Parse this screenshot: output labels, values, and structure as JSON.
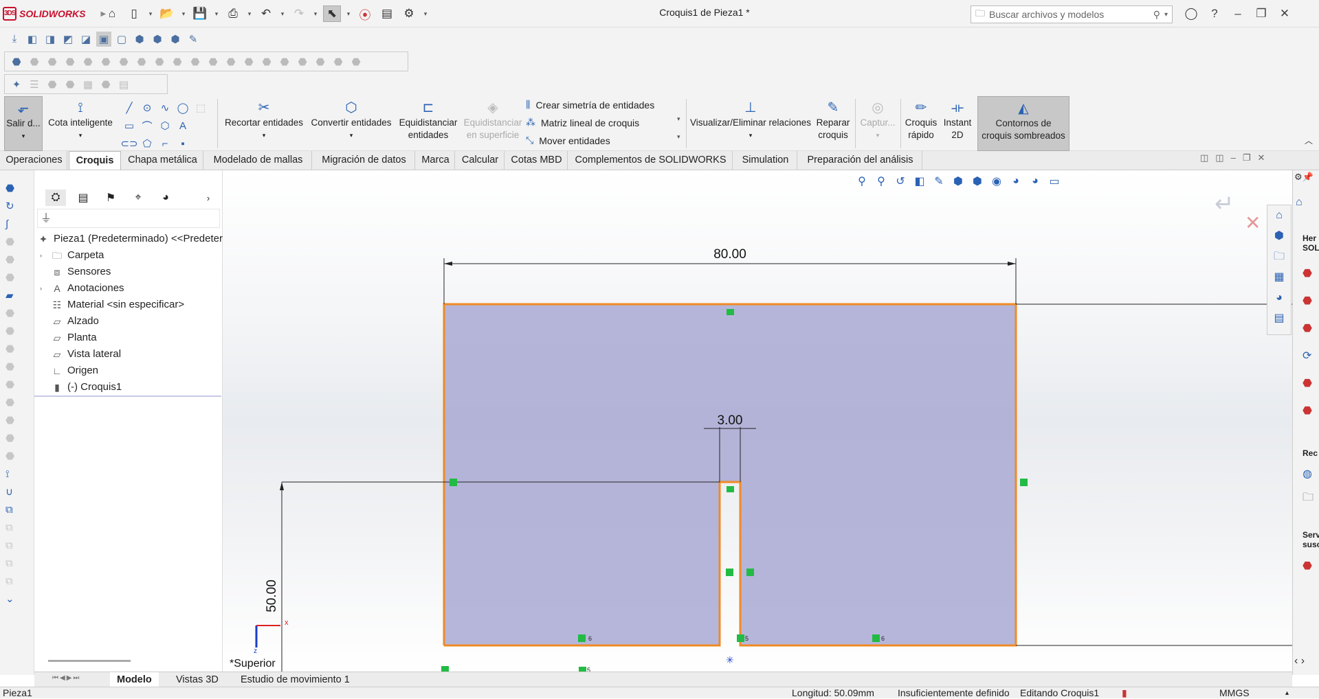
{
  "app": {
    "name": "SOLIDWORKS",
    "window_title": "Croquis1 de Pieza1 *"
  },
  "search": {
    "placeholder": "Buscar archivos y modelos"
  },
  "quick_access": [
    "home-icon",
    "new-icon",
    "open-icon",
    "save-icon",
    "print-icon",
    "undo-icon",
    "redo-icon",
    "select-icon",
    "traffic-light-icon",
    "file-properties-icon",
    "options-icon"
  ],
  "command_manager": {
    "exit_sketch": "Salir d...",
    "smart_dimension": "Cota inteligente",
    "trim": "Recortar entidades",
    "convert": "Convertir entidades",
    "offset_line1": "Equidistanciar",
    "offset_line2": "entidades",
    "offset_surface_line1": "Equidistanciar",
    "offset_surface_line2": "en superficie",
    "mirror": "Crear simetría de entidades",
    "linear_pattern": "Matriz lineal de croquis",
    "move": "Mover entidades",
    "relations": "Visualizar/Eliminar relaciones",
    "repair_line1": "Reparar",
    "repair_line2": "croquis",
    "capture": "Captur...",
    "quick_sketch_line1": "Croquis",
    "quick_sketch_line2": "rápido",
    "instant2d_line1": "Instant",
    "instant2d_line2": "2D",
    "shaded_line1": "Contornos de",
    "shaded_line2": "croquis sombreados"
  },
  "tabs": [
    "Operaciones",
    "Croquis",
    "Chapa metálica",
    "Modelado de mallas",
    "Migración de datos",
    "Marca",
    "Calcular",
    "Cotas MBD",
    "Complementos de SOLIDWORKS",
    "Simulation",
    "Preparación del análisis"
  ],
  "active_tab": "Croquis",
  "tree": {
    "root": "Pieza1 (Predeterminado) <<Predeter",
    "items": [
      {
        "label": "Carpeta",
        "expander": true
      },
      {
        "label": "Sensores",
        "expander": false
      },
      {
        "label": "Anotaciones",
        "expander": true
      },
      {
        "label": "Material <sin especificar>",
        "expander": false
      },
      {
        "label": "Alzado",
        "expander": false
      },
      {
        "label": "Planta",
        "expander": false
      },
      {
        "label": "Vista lateral",
        "expander": false
      },
      {
        "label": "Origen",
        "expander": false
      },
      {
        "label": "(-) Croquis1",
        "expander": false
      }
    ]
  },
  "sketch": {
    "dim_width": "80.00",
    "dim_slot": "3.00",
    "dim_height": "50.00",
    "view_label": "*Superior",
    "fill": "#a9a9d3",
    "edge": "#f08a24",
    "relation": "#22bb44",
    "relation_tags": [
      "6",
      "5",
      "6",
      "5"
    ]
  },
  "bottom_tabs": [
    "Modelo",
    "Vistas 3D",
    "Estudio de movimiento 1"
  ],
  "active_bottom_tab": "Modelo",
  "status": {
    "left": "Pieza1",
    "length": "Longitud: 50.09mm",
    "definition": "Insuficientemente definido",
    "editing": "Editando Croquis1",
    "units": "MMGS"
  },
  "right_panel": {
    "header": "Her SOLI",
    "recent": "Rec",
    "services": "Serv susc"
  }
}
